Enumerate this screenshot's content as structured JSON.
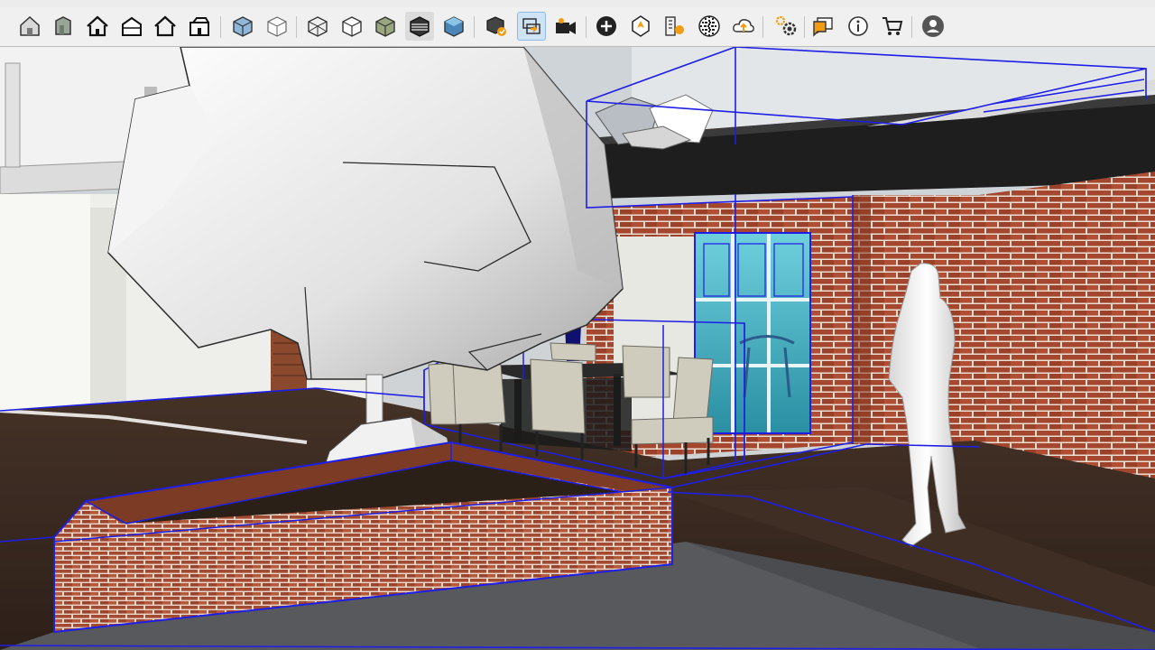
{
  "app": {
    "toolbar": {
      "groups": [
        [
          "house-icon",
          "front-view-icon",
          "house-icon",
          "house-icon",
          "house-icon",
          "house-icon"
        ],
        [
          "iso-box-icon",
          "wireframe-box-icon",
          "box-icon",
          "box-icon",
          "shaded-box-icon",
          "textured-box-icon",
          "monochrome-box-icon"
        ],
        [
          "component-icon",
          "swap-icon",
          "camera-icon"
        ],
        [
          "plus-circle-icon",
          "location-icon",
          "layers-icon",
          "pattern-icon",
          "cloud-icon"
        ],
        [
          "gear-icon",
          "chat-icon",
          "info-icon",
          "cart-icon",
          "user-icon"
        ]
      ],
      "active_icon": "swap-icon"
    },
    "viewport": {
      "scene": "3d-model-patio-with-tree-planter-dining-set-and-figure",
      "colors": {
        "sky": "#cdd3d8",
        "brick": "#a5472e",
        "mortar": "#e8ddd3",
        "floor": "#3a2a20",
        "selection": "#1e1ee6",
        "roof": "#1e1e1e",
        "glass": "#3fb7c9"
      }
    }
  }
}
